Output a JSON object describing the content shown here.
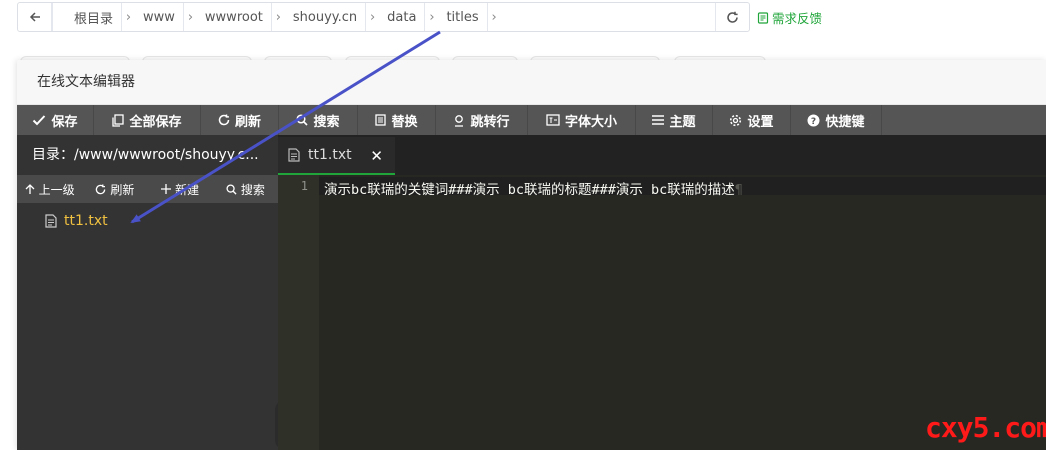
{
  "breadcrumb": {
    "items": [
      "根目录",
      "www",
      "wwwroot",
      "shouyy.cn",
      "data",
      "titles"
    ]
  },
  "feedback": {
    "label": "需求反馈"
  },
  "modal": {
    "title": "在线文本编辑器"
  },
  "toolbar": {
    "buttons": [
      {
        "label": "保存",
        "icon": "check-icon"
      },
      {
        "label": "全部保存",
        "icon": "copy-icon"
      },
      {
        "label": "刷新",
        "icon": "refresh-icon"
      },
      {
        "label": "搜索",
        "icon": "search-icon"
      },
      {
        "label": "替换",
        "icon": "replace-icon"
      },
      {
        "label": "跳转行",
        "icon": "location-icon"
      },
      {
        "label": "字体大小",
        "icon": "font-size-icon"
      },
      {
        "label": "主题",
        "icon": "menu-icon"
      },
      {
        "label": "设置",
        "icon": "gear-icon"
      },
      {
        "label": "快捷键",
        "icon": "help-icon"
      }
    ]
  },
  "sidebar": {
    "directory": "目录：/www/wwwroot/shouyy.c...",
    "tools": [
      {
        "label": "上一级",
        "icon": "arrow-up-icon"
      },
      {
        "label": "刷新",
        "icon": "refresh-icon"
      },
      {
        "label": "新建",
        "icon": "plus-icon"
      },
      {
        "label": "搜索",
        "icon": "search-icon"
      }
    ],
    "files": [
      {
        "name": "tt1.txt",
        "icon": "file-icon"
      }
    ]
  },
  "editor": {
    "tab_label": "tt1.txt",
    "line_number": "1",
    "content": "演示bc联瑞的关键词###演示 bc联瑞的标题###演示 bc联瑞的描述"
  },
  "watermark": "cxy5.com",
  "colors": {
    "accent_green": "#20a53a",
    "file_name": "#f0c040",
    "arrow": "#4a52c8",
    "watermark": "#ff1a1a"
  }
}
